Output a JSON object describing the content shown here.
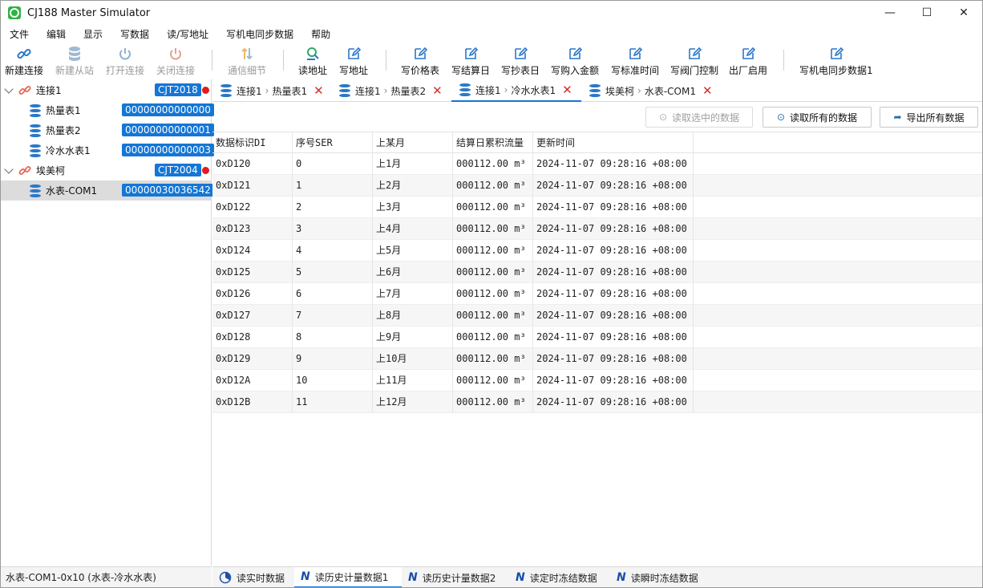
{
  "window": {
    "title": "CJ188 Master Simulator",
    "minimize": "—",
    "maximize": "☐",
    "close": "✕"
  },
  "menu": [
    "文件",
    "编辑",
    "显示",
    "写数据",
    "读/写地址",
    "写机电同步数据",
    "帮助"
  ],
  "toolbar": {
    "new_connection": "新建连接",
    "new_slave": "新建从站",
    "open_connection": "打开连接",
    "close_connection": "关闭连接",
    "comm_detail": "通信细节",
    "read_address": "读地址",
    "write_address": "写地址",
    "write_price_table": "写价格表",
    "write_settlement_day": "写结算日",
    "write_reading_day": "写抄表日",
    "write_purchase_amount": "写购入金额",
    "write_standard_time": "写标准时间",
    "write_valve_control": "写阀门控制",
    "factory_enable": "出厂启用",
    "write_sync_data1": "写机电同步数据1"
  },
  "tree": [
    {
      "label": "连接1",
      "badge": "CJT2018"
    },
    {
      "label": "热量表1",
      "badge": "00000000000000"
    },
    {
      "label": "热量表2",
      "badge": "00000000000001"
    },
    {
      "label": "冷水水表1",
      "badge": "00000000000003"
    },
    {
      "label": "埃美柯",
      "badge": "CJT2004"
    },
    {
      "label": "水表-COM1",
      "badge": "00000030036542"
    }
  ],
  "status": "水表-COM1-0x10 (水表-冷水水表)",
  "tabs": [
    {
      "conn": "连接1",
      "device": "热量表1"
    },
    {
      "conn": "连接1",
      "device": "热量表2"
    },
    {
      "conn": "连接1",
      "device": "冷水水表1"
    },
    {
      "conn": "埃美柯",
      "device": "水表-COM1"
    }
  ],
  "actions": {
    "read_selected": "读取选中的数据",
    "read_all": "读取所有的数据",
    "export_all": "导出所有数据"
  },
  "table": {
    "headers": [
      "数据标识DI",
      "序号SER",
      "上某月",
      "结算日累积流量",
      "更新时间"
    ],
    "rows": [
      [
        "0xD120",
        "0",
        "上1月",
        "000112.00 m³",
        "2024-11-07 09:28:16 +08:00"
      ],
      [
        "0xD121",
        "1",
        "上2月",
        "000112.00 m³",
        "2024-11-07 09:28:16 +08:00"
      ],
      [
        "0xD122",
        "2",
        "上3月",
        "000112.00 m³",
        "2024-11-07 09:28:16 +08:00"
      ],
      [
        "0xD123",
        "3",
        "上4月",
        "000112.00 m³",
        "2024-11-07 09:28:16 +08:00"
      ],
      [
        "0xD124",
        "4",
        "上5月",
        "000112.00 m³",
        "2024-11-07 09:28:16 +08:00"
      ],
      [
        "0xD125",
        "5",
        "上6月",
        "000112.00 m³",
        "2024-11-07 09:28:16 +08:00"
      ],
      [
        "0xD126",
        "6",
        "上7月",
        "000112.00 m³",
        "2024-11-07 09:28:16 +08:00"
      ],
      [
        "0xD127",
        "7",
        "上8月",
        "000112.00 m³",
        "2024-11-07 09:28:16 +08:00"
      ],
      [
        "0xD128",
        "8",
        "上9月",
        "000112.00 m³",
        "2024-11-07 09:28:16 +08:00"
      ],
      [
        "0xD129",
        "9",
        "上10月",
        "000112.00 m³",
        "2024-11-07 09:28:16 +08:00"
      ],
      [
        "0xD12A",
        "10",
        "上11月",
        "000112.00 m³",
        "2024-11-07 09:28:16 +08:00"
      ],
      [
        "0xD12B",
        "11",
        "上12月",
        "000112.00 m³",
        "2024-11-07 09:28:16 +08:00"
      ]
    ]
  },
  "bottom_tabs": [
    "读实时数据",
    "读历史计量数据1",
    "读历史计量数据2",
    "读定时冻结数据",
    "读瞬时冻结数据"
  ],
  "colors": {
    "accent": "#1476d6",
    "badge_bg": "#1476d6",
    "status_dot": "#e01c1c",
    "close_x": "#d0312d"
  }
}
